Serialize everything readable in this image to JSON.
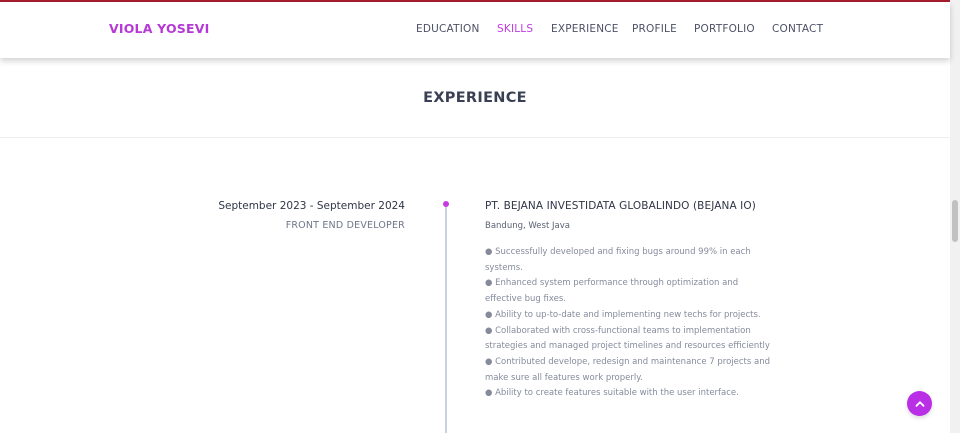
{
  "brand": "VIOLA YOSEVI",
  "nav": {
    "items": [
      {
        "label": "EDUCATION"
      },
      {
        "label": "SKILLS",
        "active": true
      },
      {
        "label": "EXPERIENCE"
      },
      {
        "label": "PROFILE"
      },
      {
        "label": "PORTFOLIO"
      },
      {
        "label": "CONTACT"
      }
    ]
  },
  "section": {
    "title": "EXPERIENCE"
  },
  "experience": {
    "period": "September 2023 - September 2024",
    "role": "FRONT END DEVELOPER",
    "company": "PT. BEJANA INVESTIDATA GLOBALINDO (BEJANA IO)",
    "location": "Bandung, West Java",
    "bullets": [
      "● Successfully developed and fixing bugs around 99% in each systems.",
      "● Enhanced system performance through optimization and effective bug fixes.",
      "● Ability to up-to-date and implementing new techs for projects.",
      "● Collaborated with cross-functional teams to implementation strategies and managed project timelines and resources efficiently",
      "● Contributed develope, redesign and maintenance 7 projects and make sure all features work properly.",
      "● Ability to create features suitable with the user interface."
    ]
  },
  "colors": {
    "accent": "#bf3ce0",
    "brand": "#b638d6",
    "back_to_top": "#b82fe6",
    "timeline_line": "#c9d2e3"
  },
  "icons": {
    "back_to_top": "chevron-up-icon"
  }
}
